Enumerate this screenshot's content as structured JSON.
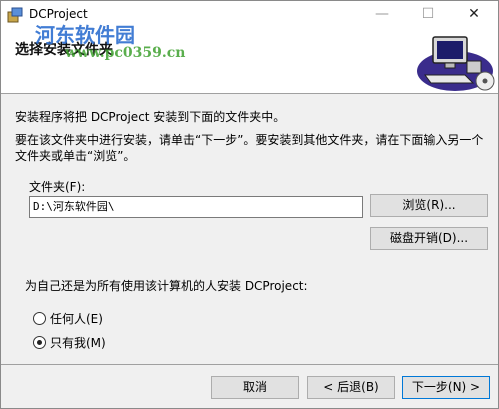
{
  "window": {
    "title": "DCProject",
    "minimize_glyph": "—",
    "maximize_glyph": "☐",
    "close_glyph": "✕"
  },
  "header": {
    "title": "选择安装文件夹",
    "watermark_site": "河东软件园",
    "watermark_url": "www.pc0359.cn"
  },
  "body": {
    "line1": "安装程序将把 DCProject 安装到下面的文件夹中。",
    "line2": "要在该文件夹中进行安装，请单击“下一步”。要安装到其他文件夹，请在下面输入另一个文件夹或单击“浏览”。",
    "folder_label": "文件夹(F):",
    "folder_value": "D:\\河东软件园\\",
    "browse_button": "浏览(R)...",
    "disk_cost_button": "磁盘开销(D)...",
    "install_for_question": "为自己还是为所有使用该计算机的人安装 DCProject:",
    "options": [
      {
        "label": "任何人(E)",
        "checked": false
      },
      {
        "label": "只有我(M)",
        "checked": true
      }
    ]
  },
  "footer": {
    "cancel": "取消",
    "back": "< 后退(B)",
    "next": "下一步(N) >"
  },
  "colors": {
    "watermark_blue": "#2e6fd0",
    "watermark_green": "#3ea02e",
    "focus_border": "#0078d7"
  }
}
